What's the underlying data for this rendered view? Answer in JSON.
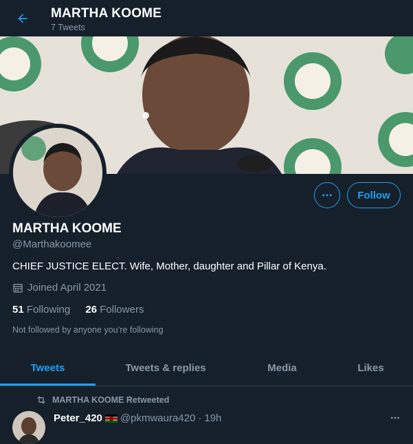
{
  "header": {
    "title": "MARTHA KOOME",
    "subtitle": "7 Tweets"
  },
  "profile": {
    "name": "MARTHA KOOME",
    "handle": "@Marthakoomee",
    "bio": "CHIEF JUSTICE ELECT. Wife, Mother, daughter and Pillar of Kenya.",
    "joined": "Joined April 2021",
    "following_count": "51",
    "following_label": "Following",
    "followers_count": "26",
    "followers_label": "Followers",
    "not_followed": "Not followed by anyone you’re following"
  },
  "actions": {
    "follow_label": "Follow"
  },
  "tabs": [
    {
      "label": "Tweets",
      "active": true
    },
    {
      "label": "Tweets & replies",
      "active": false
    },
    {
      "label": "Media",
      "active": false
    },
    {
      "label": "Likes",
      "active": false
    }
  ],
  "tweet": {
    "retweet_label": "MARTHA KOOME Retweeted",
    "author_name": "Peter_420",
    "author_handle": "@pkmwaura420",
    "separator": "·",
    "time": "19h"
  },
  "colors": {
    "background": "#15202b",
    "accent": "#1da1f2",
    "secondary_text": "#8899a6",
    "border": "#38444d"
  },
  "icons": [
    "back-arrow-icon",
    "calendar-icon",
    "more-icon",
    "retweet-icon",
    "kenya-flag-icon"
  ]
}
